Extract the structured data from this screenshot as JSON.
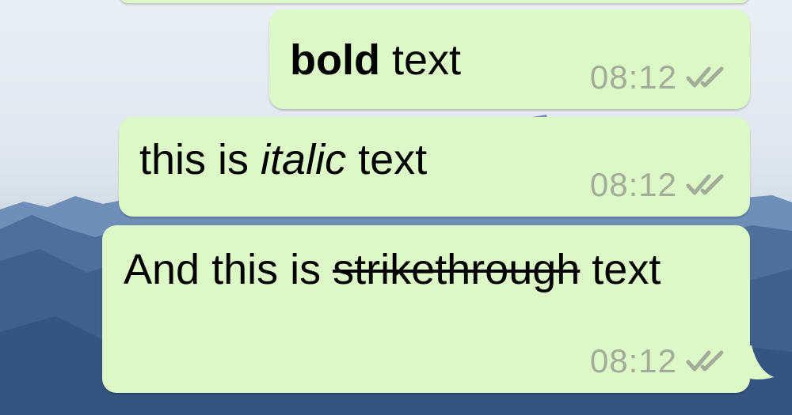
{
  "chat": {
    "background": {
      "sky_color": "#e3eaf1",
      "mountain_color": "#4d6f9c"
    },
    "bubble_color": "#dcf8c6",
    "meta_color": "#a1ad98",
    "messages": [
      {
        "segments": [
          {
            "style": "bold",
            "text": "bold"
          },
          {
            "style": "normal",
            "text": " text"
          }
        ],
        "time": "08:12",
        "status_icon": "double-check-icon"
      },
      {
        "segments": [
          {
            "style": "normal",
            "text": "this is "
          },
          {
            "style": "italic",
            "text": "italic"
          },
          {
            "style": "normal",
            "text": " text"
          }
        ],
        "time": "08:12",
        "status_icon": "double-check-icon"
      },
      {
        "segments": [
          {
            "style": "normal",
            "text": "And this is "
          },
          {
            "style": "strike",
            "text": "strikethrough"
          },
          {
            "style": "normal",
            "text": " text"
          }
        ],
        "time": "08:12",
        "status_icon": "double-check-icon"
      }
    ]
  }
}
